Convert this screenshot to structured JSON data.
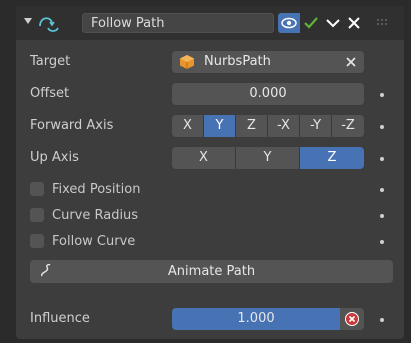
{
  "header": {
    "name": "Follow Path",
    "collapse_icon": "triangle-down-icon",
    "constraint_icon": "follow-path-icon",
    "eye_icon": "eye-icon",
    "check_icon": "checkmark-icon",
    "menu_icon": "chevron-down-icon",
    "close_icon": "close-icon",
    "grip_icon": "drag-grip-icon"
  },
  "target": {
    "label": "Target",
    "value": "NurbsPath",
    "icon": "curve-object-icon",
    "clear_icon": "close-icon"
  },
  "offset": {
    "label": "Offset",
    "value": "0.000"
  },
  "forward_axis": {
    "label": "Forward Axis",
    "options": [
      "X",
      "Y",
      "Z",
      "-X",
      "-Y",
      "-Z"
    ],
    "selected": "Y"
  },
  "up_axis": {
    "label": "Up Axis",
    "options": [
      "X",
      "Y",
      "Z"
    ],
    "selected": "Z"
  },
  "checks": [
    {
      "label": "Fixed Position",
      "checked": false
    },
    {
      "label": "Curve Radius",
      "checked": false
    },
    {
      "label": "Follow Curve",
      "checked": false
    }
  ],
  "animate": {
    "label": "Animate Path",
    "icon": "curve-path-icon"
  },
  "influence": {
    "label": "Influence",
    "value": "1.000",
    "level": 1.0,
    "icon": "disable-keep-transform-icon"
  },
  "colors": {
    "accent": "#4772b3",
    "panel": "#3d3d3d",
    "field": "#545454",
    "check_green": "#5fb33a",
    "error_red": "#c83a3a"
  }
}
